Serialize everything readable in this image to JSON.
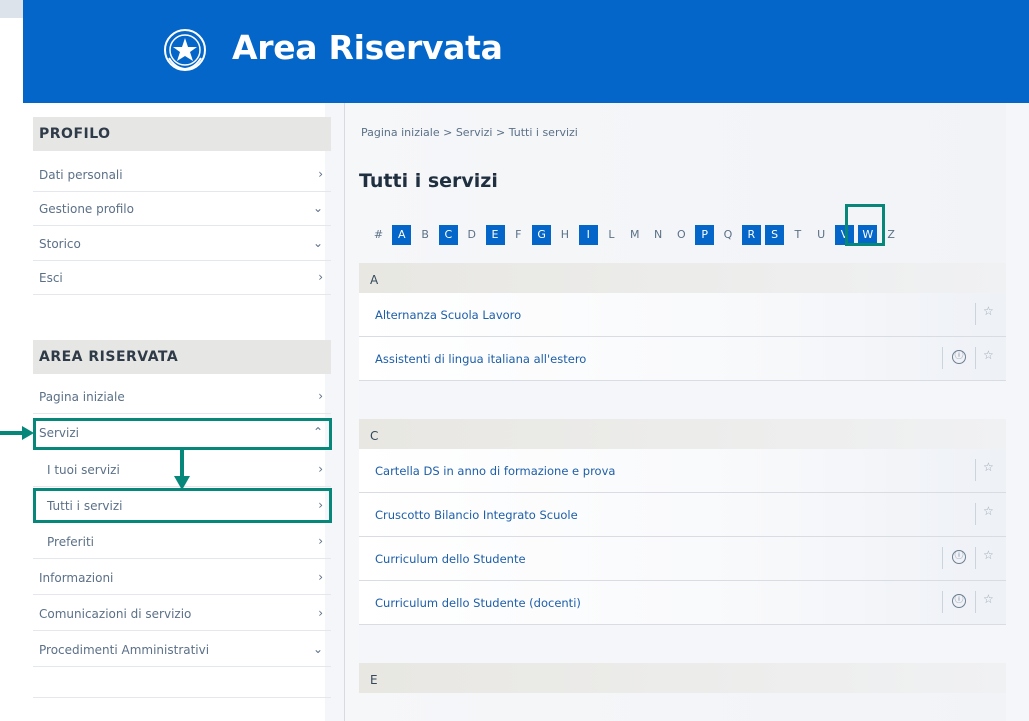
{
  "header": {
    "title": "Area Riservata"
  },
  "sidebar": {
    "profilo": {
      "heading": "PROFILO",
      "items": [
        {
          "label": "Dati personali",
          "chevron": "›"
        },
        {
          "label": "Gestione profilo",
          "chevron": "⌄"
        },
        {
          "label": "Storico",
          "chevron": "⌄"
        },
        {
          "label": "Esci",
          "chevron": "›"
        }
      ]
    },
    "area": {
      "heading": "AREA RISERVATA",
      "items": [
        {
          "label": "Pagina iniziale",
          "chevron": "›"
        },
        {
          "label": "Servizi",
          "chevron": "⌃"
        },
        {
          "label": "I tuoi servizi",
          "chevron": "›"
        },
        {
          "label": "Tutti i servizi",
          "chevron": "›"
        },
        {
          "label": "Preferiti",
          "chevron": "›"
        },
        {
          "label": "Informazioni",
          "chevron": "›"
        },
        {
          "label": "Comunicazioni di servizio",
          "chevron": "›"
        },
        {
          "label": "Procedimenti Amministrativi",
          "chevron": "⌄"
        }
      ]
    }
  },
  "main": {
    "breadcrumb": "Pagina iniziale > Servizi > Tutti i servizi",
    "title": "Tutti i servizi",
    "alphabet": [
      {
        "letter": "#",
        "active": false
      },
      {
        "letter": "A",
        "active": true
      },
      {
        "letter": "B",
        "active": false
      },
      {
        "letter": "C",
        "active": true
      },
      {
        "letter": "D",
        "active": false
      },
      {
        "letter": "E",
        "active": true
      },
      {
        "letter": "F",
        "active": false
      },
      {
        "letter": "G",
        "active": true
      },
      {
        "letter": "H",
        "active": false
      },
      {
        "letter": "I",
        "active": true
      },
      {
        "letter": "L",
        "active": false
      },
      {
        "letter": "M",
        "active": false
      },
      {
        "letter": "N",
        "active": false
      },
      {
        "letter": "O",
        "active": false
      },
      {
        "letter": "P",
        "active": true
      },
      {
        "letter": "Q",
        "active": false
      },
      {
        "letter": "R",
        "active": true
      },
      {
        "letter": "S",
        "active": true
      },
      {
        "letter": "T",
        "active": false
      },
      {
        "letter": "U",
        "active": false
      },
      {
        "letter": "V",
        "active": true
      },
      {
        "letter": "W",
        "active": true
      },
      {
        "letter": "Z",
        "active": false
      }
    ],
    "groups": [
      {
        "letter": "A",
        "services": [
          {
            "name": "Alternanza Scuola Lavoro",
            "info": false
          },
          {
            "name": "Assistenti di lingua italiana all'estero",
            "info": true
          }
        ]
      },
      {
        "letter": "C",
        "services": [
          {
            "name": "Cartella DS in anno di formazione e prova",
            "info": false
          },
          {
            "name": "Cruscotto Bilancio Integrato Scuole",
            "info": false
          },
          {
            "name": "Curriculum dello Studente",
            "info": true
          },
          {
            "name": "Curriculum dello Studente (docenti)",
            "info": true
          }
        ]
      },
      {
        "letter": "E",
        "services": []
      }
    ]
  },
  "icons": {
    "info": "ⓘ",
    "star": "☆"
  },
  "colors": {
    "brand": "#0466c8",
    "highlight": "#07877a",
    "link": "#1d5ea8"
  }
}
